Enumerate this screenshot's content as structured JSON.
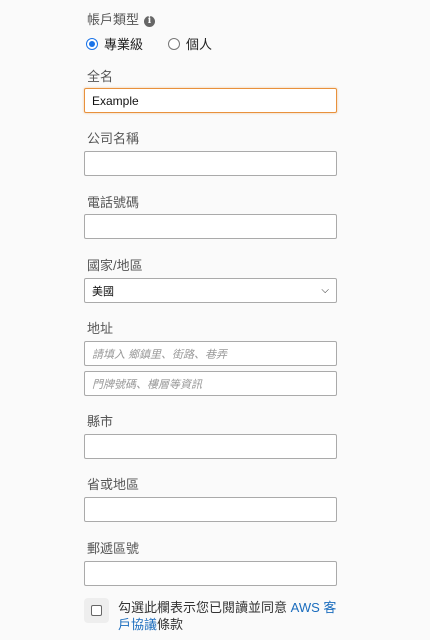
{
  "account_type": {
    "label": "帳戶類型",
    "info_icon": "i",
    "options": [
      {
        "label": "專業級",
        "checked": true
      },
      {
        "label": "個人",
        "checked": false
      }
    ]
  },
  "full_name": {
    "label": "全名",
    "value": "Example"
  },
  "company": {
    "label": "公司名稱",
    "value": ""
  },
  "phone": {
    "label": "電話號碼",
    "value": ""
  },
  "country": {
    "label": "國家/地區",
    "selected": "美國"
  },
  "address": {
    "label": "地址",
    "line1_placeholder": "請填入 鄉鎮里、街路、巷弄",
    "line2_placeholder": "門牌號碼、樓層等資訊"
  },
  "city": {
    "label": "縣市",
    "value": ""
  },
  "state": {
    "label": "省或地區",
    "value": ""
  },
  "postal": {
    "label": "郵遞區號",
    "value": ""
  },
  "agreement": {
    "text_before": "勾選此欄表示您已閱讀並同意 ",
    "link_text": "AWS 客戶協議",
    "text_after": "條款"
  }
}
